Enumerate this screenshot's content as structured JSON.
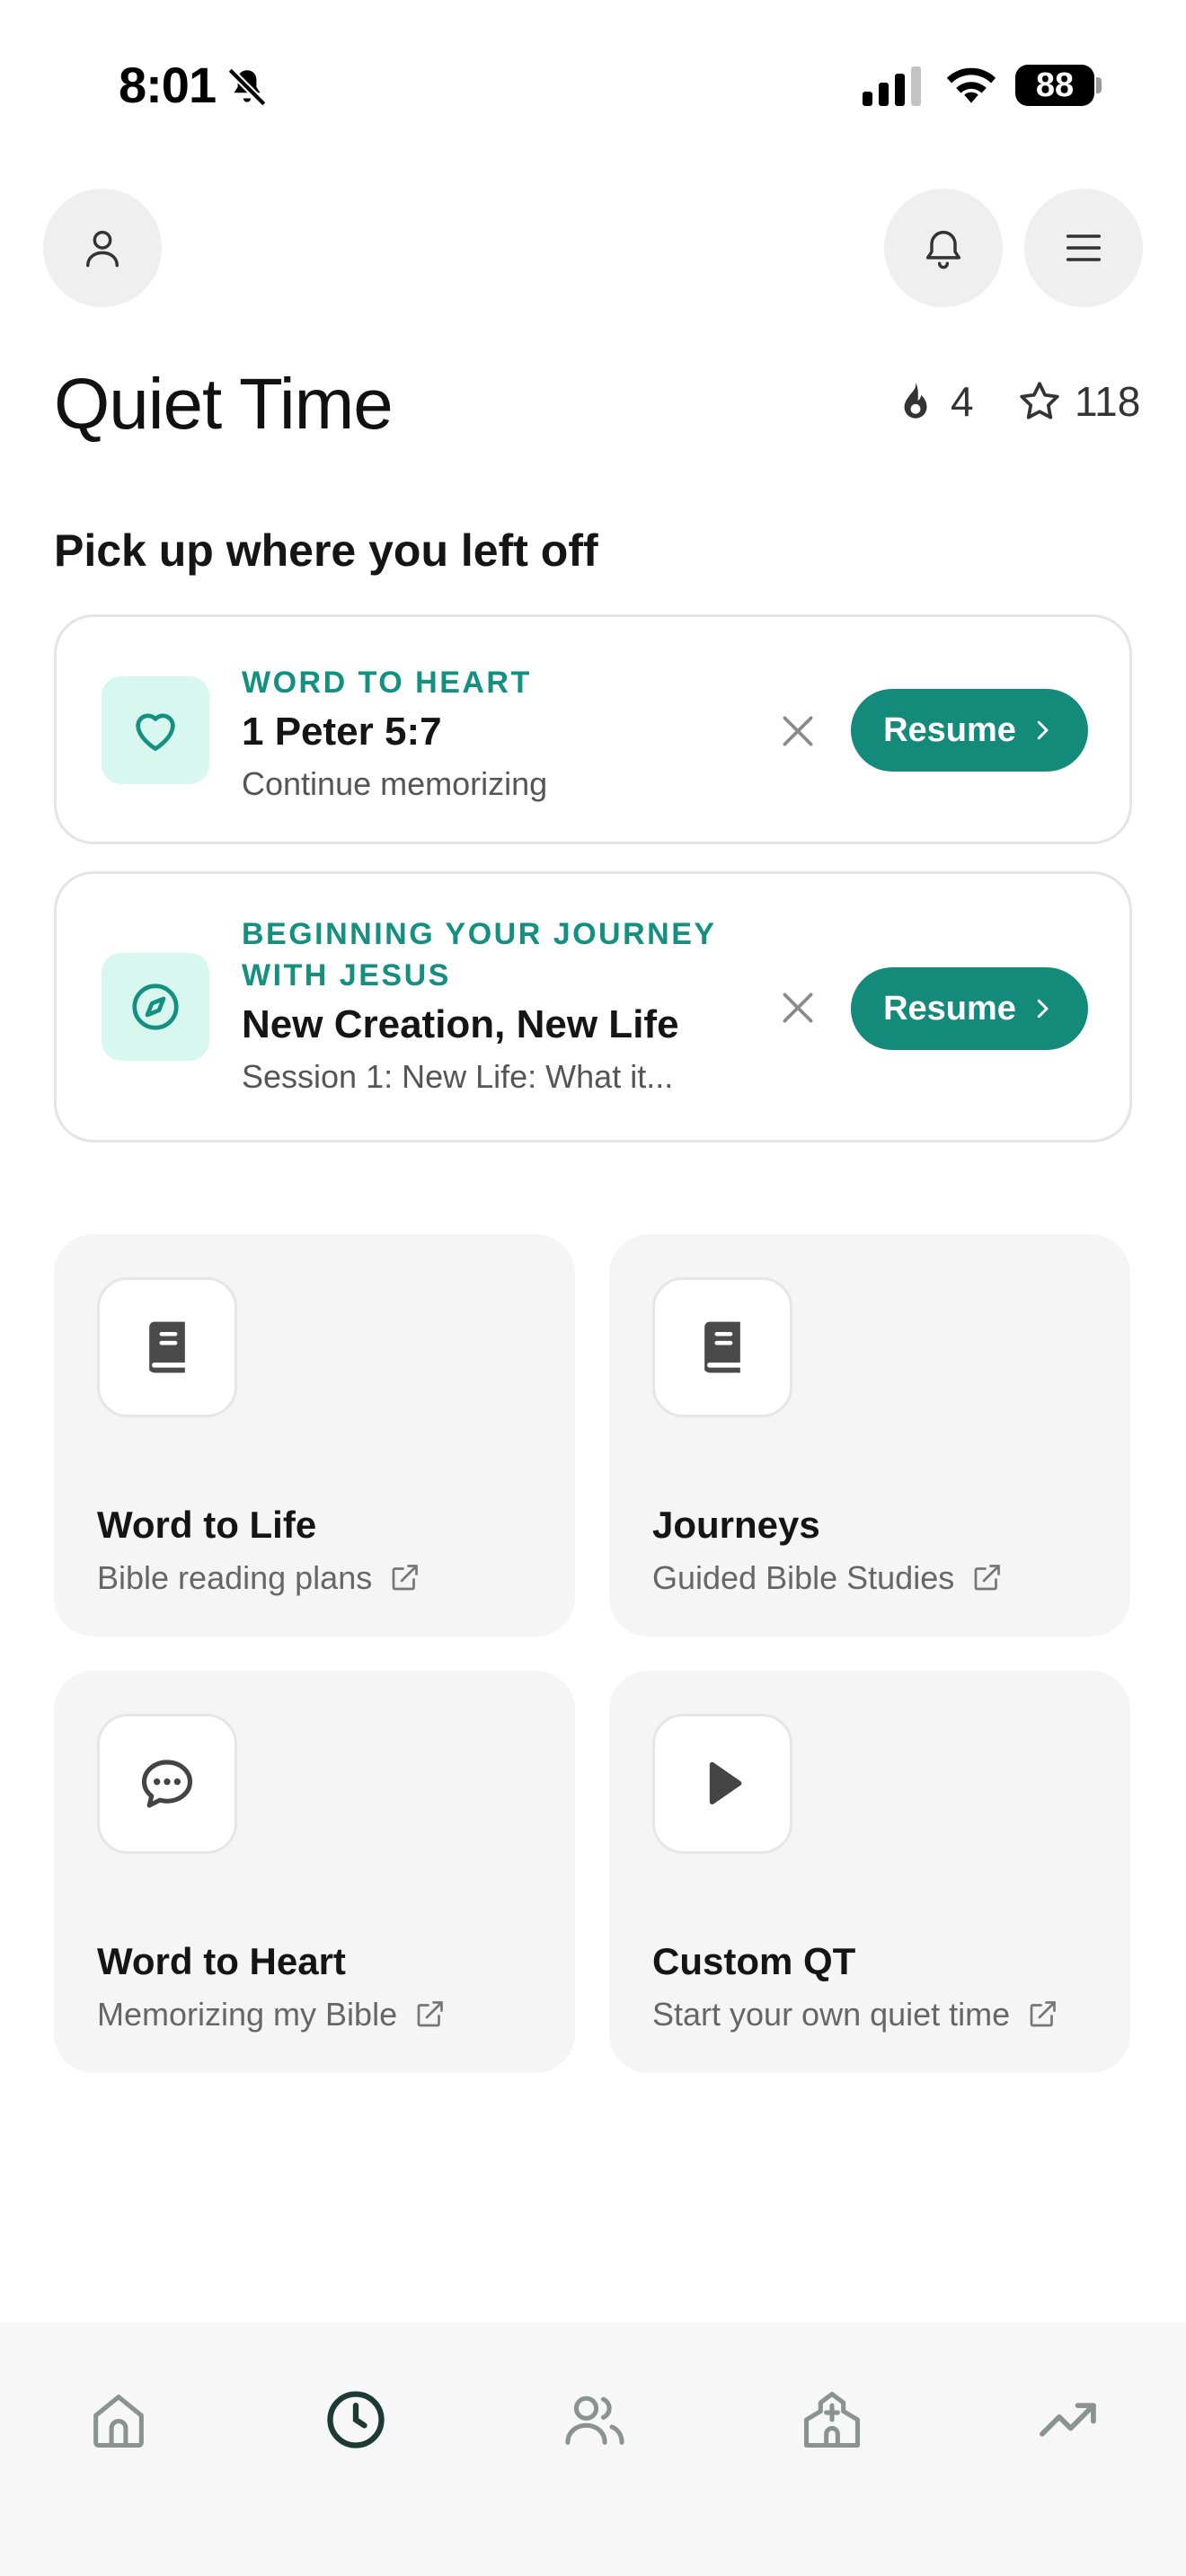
{
  "status_bar": {
    "time": "8:01",
    "battery": "88",
    "icons": [
      "bell-slash-icon",
      "cellular-signal-icon",
      "wifi-icon",
      "battery-icon"
    ]
  },
  "header": {
    "title": "Quiet Time",
    "streak": "4",
    "stars": "118",
    "icons": [
      "person-icon",
      "bell-icon",
      "hamburger-menu-icon",
      "flame-icon",
      "star-icon"
    ]
  },
  "continue_section": {
    "title": "Pick up where you left off",
    "cards": [
      {
        "category": "WORD TO HEART",
        "title": "1 Peter 5:7",
        "subtitle": "Continue memorizing",
        "button": "Resume",
        "icon": "heart-icon"
      },
      {
        "category": "BEGINNING YOUR JOURNEY WITH JESUS",
        "title": "New Creation, New Life",
        "subtitle": "Session 1: New Life: What it...",
        "button": "Resume",
        "icon": "compass-icon"
      }
    ]
  },
  "tiles": [
    {
      "title": "Word to Life",
      "subtitle": "Bible reading plans",
      "icon": "book-icon"
    },
    {
      "title": "Journeys",
      "subtitle": "Guided Bible Studies",
      "icon": "book-icon"
    },
    {
      "title": "Word to Heart",
      "subtitle": "Memorizing my Bible",
      "icon": "chat-bubble-icon"
    },
    {
      "title": "Custom QT",
      "subtitle": "Start your own quiet time",
      "icon": "play-icon"
    }
  ],
  "bottom_nav": {
    "items": [
      {
        "icon": "home-icon",
        "active": false
      },
      {
        "icon": "clock-icon",
        "active": true
      },
      {
        "icon": "people-icon",
        "active": false
      },
      {
        "icon": "church-icon",
        "active": false
      },
      {
        "icon": "trending-up-icon",
        "active": false
      }
    ]
  },
  "colors": {
    "accent": "#148a7b",
    "accent_text": "#13907f",
    "icon_bg": "#d7f7ef",
    "tile_bg": "#f5f5f5",
    "nav_bg": "#f6f7f6"
  }
}
